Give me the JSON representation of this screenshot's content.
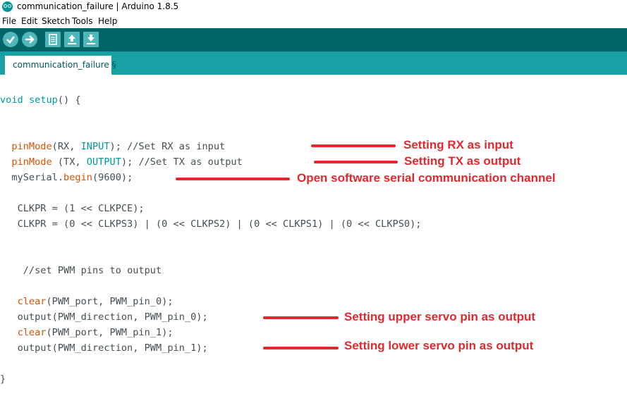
{
  "window": {
    "title": "communication_failure | Arduino 1.8.5"
  },
  "menu": [
    "File",
    "Edit",
    "Sketch",
    "Tools",
    "Help"
  ],
  "toolbar": {
    "buttons": [
      "verify-icon",
      "upload-arrow-icon",
      "new-sketch-icon",
      "open-sketch-icon",
      "save-sketch-icon"
    ]
  },
  "tab": {
    "label": "communication_failure §"
  },
  "code": {
    "l1": {
      "a": "void",
      "b": " ",
      "c": "setup",
      "d": "() {"
    },
    "l2": {
      "a": "pinMode",
      "b": "(RX, ",
      "c": "INPUT",
      "d": "); //Set RX as input"
    },
    "l3": {
      "a": "pinMode",
      "b": " (TX, ",
      "c": "OUTPUT",
      "d": "); //Set TX as output"
    },
    "l4": {
      "a": "mySerial.",
      "b": "begin",
      "c": "(9600);"
    },
    "l5": "CLKPR = (1 << CLKPCE);",
    "l6": "CLKPR = (0 << CLKPS3) | (0 << CLKPS2) | (0 << CLKPS1) | (0 << CLKPS0);",
    "l7": "//set PWM pins to output",
    "l8": {
      "a": "clear",
      "b": "(PWM_port, PWM_pin_0);"
    },
    "l9": "output(PWM_direction, PWM_pin_0);",
    "l10": {
      "a": "clear",
      "b": "(PWM_port, PWM_pin_1);"
    },
    "l11": "output(PWM_direction, PWM_pin_1);",
    "l12": "}"
  },
  "annotations": {
    "rx": "Setting RX as input",
    "tx": "Setting TX as output",
    "serial": "Open software serial communication channel",
    "upper": "Setting upper servo pin as output",
    "lower": "Setting lower servo pin as output"
  },
  "colors": {
    "toolbar": "#006468",
    "tabbar": "#17a1a5",
    "keyword": "#00979c",
    "function": "#d35400",
    "annotation": "#e0292f"
  }
}
